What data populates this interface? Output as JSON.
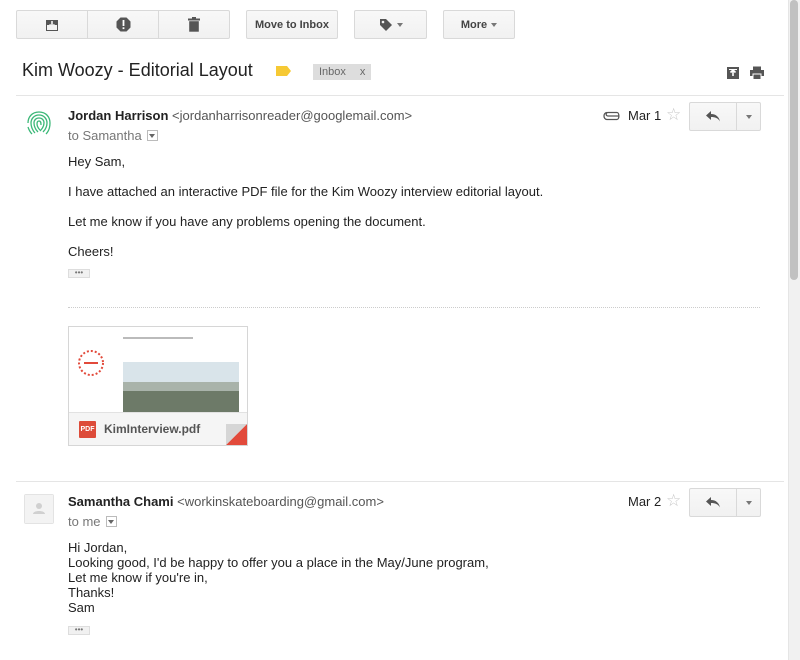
{
  "toolbar": {
    "archive_icon": "archive-icon",
    "spam_icon": "report-spam-icon",
    "delete_icon": "trash-icon",
    "move_to_inbox": "Move to Inbox",
    "labels_icon": "label-icon",
    "more": "More"
  },
  "thread": {
    "subject": "Kim Woozy - Editorial Layout",
    "label_color": "#f6c934",
    "inbox_label": "Inbox",
    "inbox_remove": "x"
  },
  "messages": [
    {
      "sender_name": "Jordan Harrison",
      "sender_email": "<jordanharrisonreader@googlemail.com>",
      "to": "to Samantha",
      "date": "Mar 1",
      "has_attachment": true,
      "lines": [
        "Hey Sam,",
        "I have attached an interactive PDF file for the Kim Woozy interview editorial layout.",
        "Let me know if you have any problems opening the document.",
        "Cheers!"
      ],
      "attachment": {
        "type_label": "PDF",
        "filename": "KimInterview.pdf"
      }
    },
    {
      "sender_name": "Samantha Chami",
      "sender_email": "<workinskateboarding@gmail.com>",
      "to": "to me",
      "date": "Mar 2",
      "lines": [
        "Hi Jordan,",
        "Looking good, I'd be happy to offer you a place in the May/June program,",
        "Let me know if you're in,",
        "Thanks!",
        "Sam"
      ]
    }
  ],
  "common": {
    "ellipsis": "•••"
  },
  "colors": {
    "accent_red": "#dd4b39",
    "avatar_green": "#3cb878"
  }
}
